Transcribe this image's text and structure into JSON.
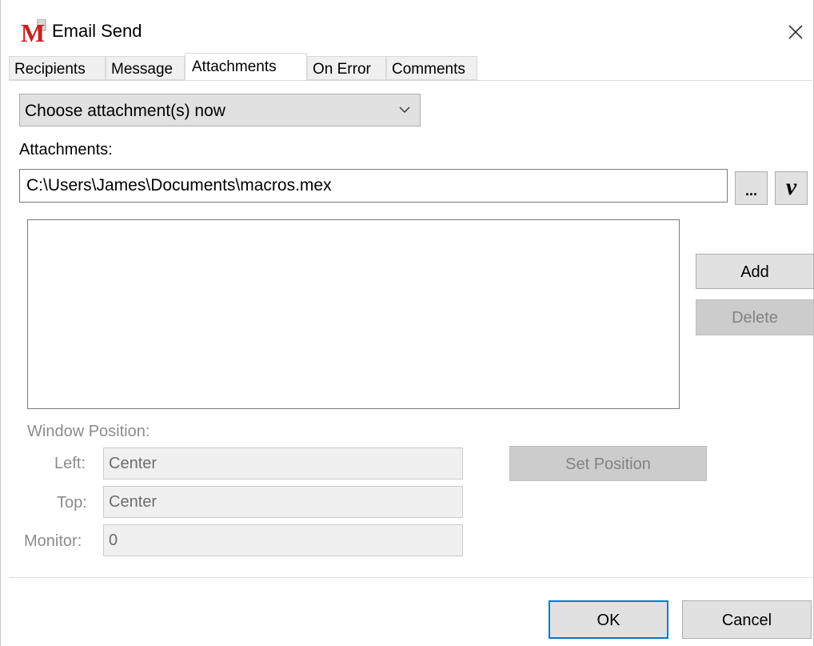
{
  "window": {
    "title": "Email Send",
    "logo_letter": "M"
  },
  "tabs": [
    {
      "label": "Recipients",
      "active": false
    },
    {
      "label": "Message",
      "active": false
    },
    {
      "label": "Attachments",
      "active": true
    },
    {
      "label": "On Error",
      "active": false
    },
    {
      "label": "Comments",
      "active": false
    }
  ],
  "attachment_mode": {
    "selected": "Choose attachment(s) now"
  },
  "attachments": {
    "label": "Attachments:",
    "path_value": "C:\\Users\\James\\Documents\\macros.mex",
    "browse_label": "...",
    "variable_label": "v",
    "list_items": [],
    "add_label": "Add",
    "delete_label": "Delete"
  },
  "window_position": {
    "heading": "Window Position:",
    "left_label": "Left:",
    "left_value": "Center",
    "top_label": "Top:",
    "top_value": "Center",
    "monitor_label": "Monitor:",
    "monitor_value": "0",
    "set_position_label": "Set Position"
  },
  "footer": {
    "ok_label": "OK",
    "cancel_label": "Cancel"
  },
  "colors": {
    "logo_red": "#cc1f1f",
    "focus_blue": "#0078d7",
    "disabled_text": "#8c8c8c"
  }
}
